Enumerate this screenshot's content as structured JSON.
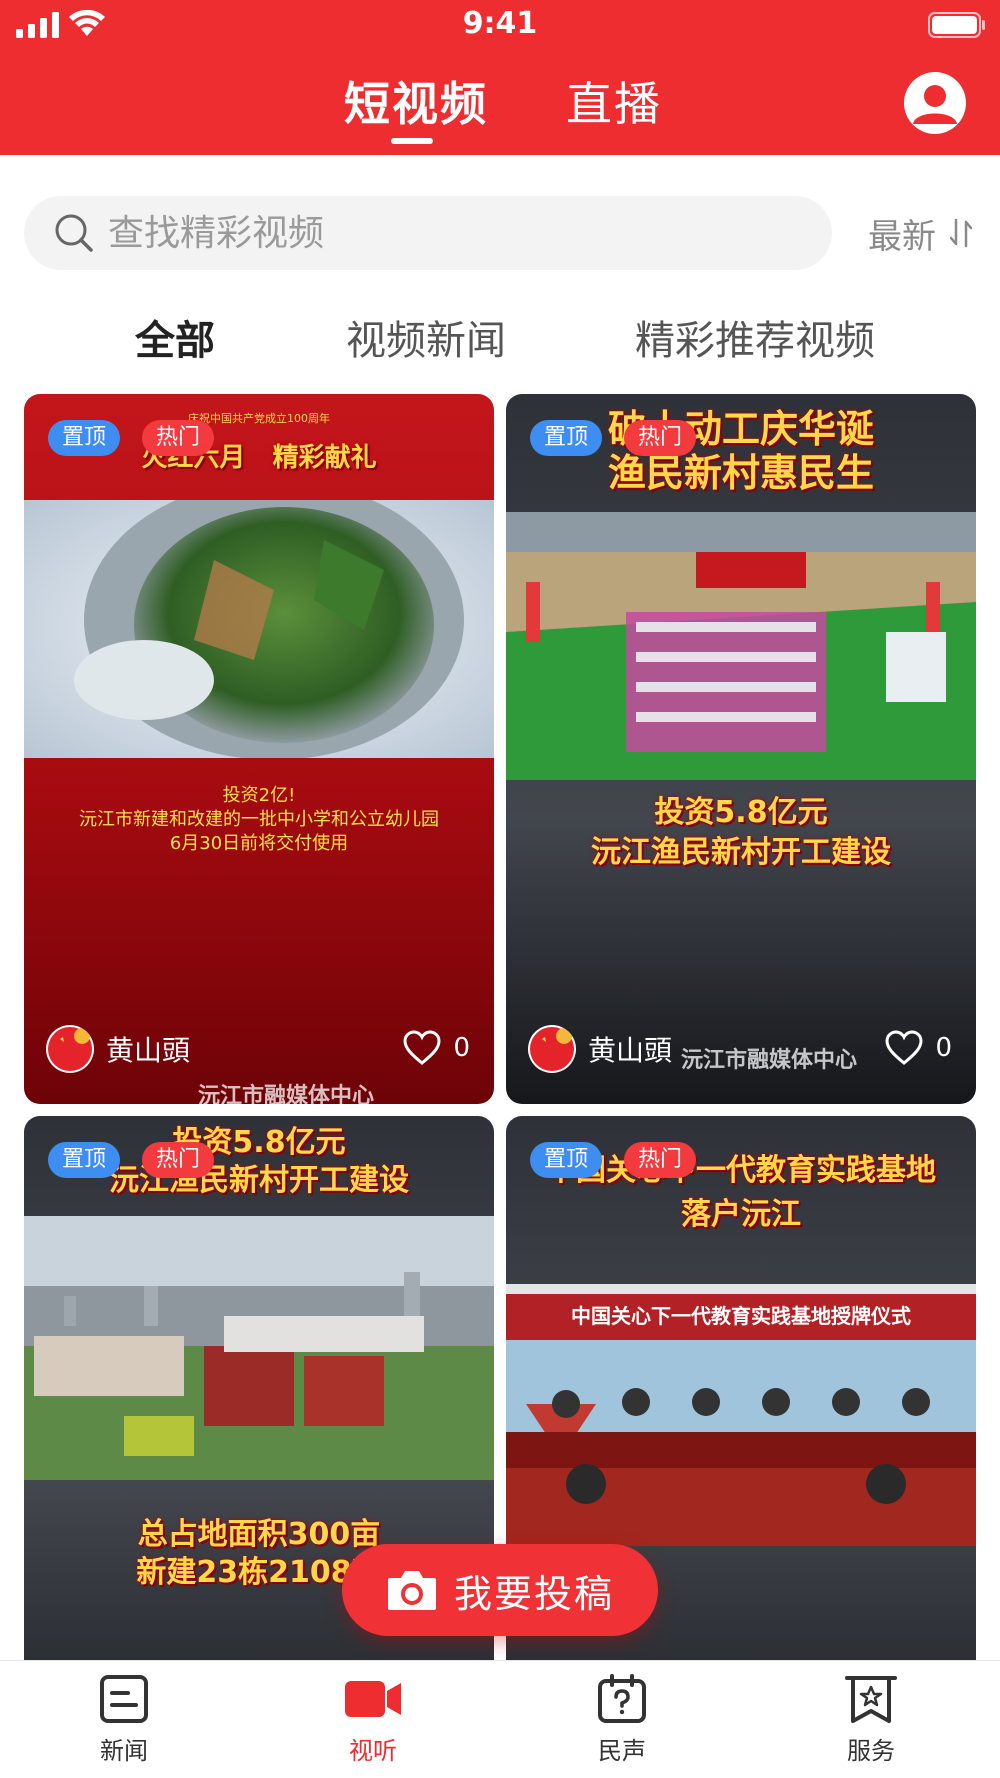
{
  "status_bar": {
    "time": "9:41"
  },
  "header": {
    "tabs": [
      {
        "label": "短视频",
        "active": true
      },
      {
        "label": "直播",
        "active": false
      }
    ],
    "profile_icon": "user-icon"
  },
  "search": {
    "placeholder": "查找精彩视频",
    "value": ""
  },
  "sort": {
    "label": "最新",
    "icon": "sort-icon"
  },
  "categories": [
    {
      "label": "全部",
      "active": true
    },
    {
      "label": "视频新闻",
      "active": false
    },
    {
      "label": "精彩推荐视频",
      "active": false
    }
  ],
  "badges": {
    "top": "置顶",
    "hot": "热门"
  },
  "cards": [
    {
      "overlay_banner": "火红六月   精彩献礼",
      "overlay_small": "庆祝中国共产党成立100周年",
      "caption_lines": [
        "投资2亿!",
        "沅江市新建和改建的一批中小学和公立幼儿园",
        "6月30日前将交付使用"
      ],
      "author": "黄山頭",
      "likes": "0",
      "watermark": "沅江市融媒体中心"
    },
    {
      "overlay_lines": [
        "破土动工庆华诞",
        "渔民新村惠民生"
      ],
      "caption_lines": [
        "投资5.8亿元",
        "沅江渔民新村开工建设"
      ],
      "author": "黄山頭",
      "likes": "0",
      "watermark": "沅江市融媒体中心"
    },
    {
      "overlay_lines": [
        "投资5.8亿元",
        "沅江渔民新村开工建设"
      ],
      "caption_lines": [
        "总占地面积300亩",
        "新建23栋2108套"
      ]
    },
    {
      "overlay_lines": [
        "中国关心下一代教育实践基地",
        "落户沅江"
      ],
      "inner_banner": "中国关心下一代教育实践基地授牌仪式"
    }
  ],
  "submit": {
    "label": "我要投稿",
    "icon": "camera-icon"
  },
  "bottom_nav": [
    {
      "label": "新闻",
      "icon": "news-icon",
      "active": false
    },
    {
      "label": "视听",
      "icon": "video-icon",
      "active": true
    },
    {
      "label": "民声",
      "icon": "question-icon",
      "active": false
    },
    {
      "label": "服务",
      "icon": "bookmark-star-icon",
      "active": false
    }
  ],
  "colors": {
    "brand_red": "#ee2d31",
    "badge_blue": "#3d8ef0",
    "badge_red": "#f23a3f",
    "caption_yellow": "#ffd84a"
  }
}
